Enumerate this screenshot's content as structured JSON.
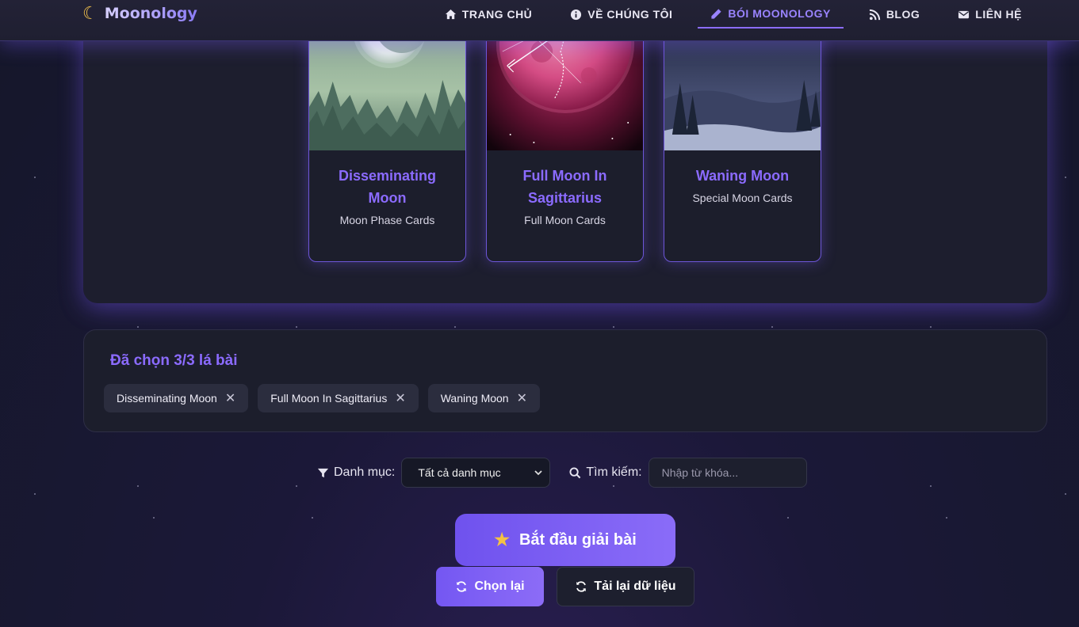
{
  "header": {
    "logo_text": "Moonology",
    "nav": [
      {
        "label": "TRANG CHỦ",
        "icon": "home-icon"
      },
      {
        "label": "VỀ CHÚNG TÔI",
        "icon": "info-icon"
      },
      {
        "label": "BÓI MOONOLOGY",
        "icon": "pencil-icon",
        "active": true
      },
      {
        "label": "BLOG",
        "icon": "rss-icon"
      },
      {
        "label": "LIÊN HỆ",
        "icon": "envelope-icon"
      }
    ]
  },
  "cards": [
    {
      "title": "Disseminating Moon",
      "category": "Moon Phase Cards"
    },
    {
      "title": "Full Moon In Sagittarius",
      "category": "Full Moon Cards"
    },
    {
      "title": "Waning Moon",
      "category": "Special Moon Cards"
    }
  ],
  "selected": {
    "title": "Đã chọn 3/3 lá bài",
    "items": [
      "Disseminating Moon",
      "Full Moon In Sagittarius",
      "Waning Moon"
    ],
    "remove_glyph": "✕"
  },
  "filters": {
    "category_label": "Danh mục:",
    "category_value": "Tất cả danh mục",
    "search_label": "Tìm kiếm:",
    "search_placeholder": "Nhập từ khóa..."
  },
  "actions": {
    "start_label": "Bắt đầu giải bài",
    "reset_label": "Chọn lại",
    "reload_label": "Tải lại dữ liệu"
  },
  "colors": {
    "accent": "#8b6bff",
    "button_gradient_start": "#6f52ee",
    "star": "#f4c243"
  }
}
